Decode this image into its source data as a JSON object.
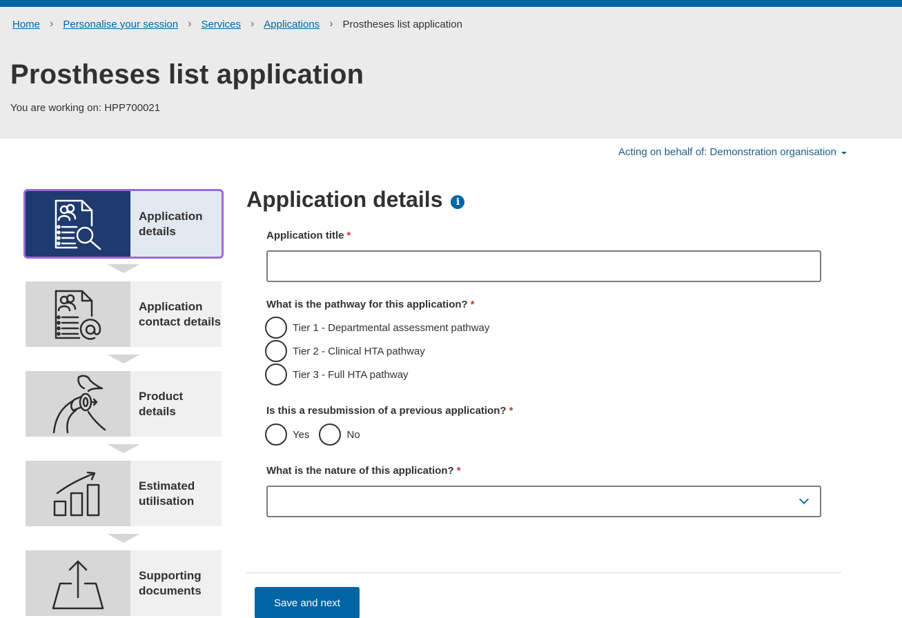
{
  "breadcrumb": {
    "items": [
      "Home",
      "Personalise your session",
      "Services",
      "Applications"
    ],
    "current": "Prostheses list application",
    "separator": "›"
  },
  "page": {
    "title": "Prostheses list application",
    "working_on": "You are working on: HPP700021"
  },
  "acting": {
    "label": "Acting on behalf of: Demonstration organisation"
  },
  "steps": [
    {
      "label": "Application details",
      "icon": "application-details-icon",
      "active": true
    },
    {
      "label": "Application contact details",
      "icon": "contact-details-icon",
      "active": false
    },
    {
      "label": "Product details",
      "icon": "hip-prosthesis-icon",
      "active": false
    },
    {
      "label": "Estimated utilisation",
      "icon": "bar-chart-growth-icon",
      "active": false
    },
    {
      "label": "Supporting documents",
      "icon": "upload-icon",
      "active": false
    }
  ],
  "form": {
    "section_title": "Application details",
    "info_glyph": "i",
    "required_mark": "*",
    "title_label": "Application title",
    "title_value": "",
    "pathway_label": "What is the pathway for this application?",
    "pathway_options": [
      "Tier 1 - Departmental assessment pathway",
      "Tier 2 - Clinical HTA pathway",
      "Tier 3 - Full HTA pathway"
    ],
    "resubmission_label": "Is this a resubmission of a previous application?",
    "resubmission_options": [
      "Yes",
      "No"
    ],
    "nature_label": "What is the nature of this application?",
    "nature_value": ""
  },
  "actions": {
    "save_next": "Save and next"
  },
  "colors": {
    "brand_blue": "#0065a4",
    "active_step": "#1f3a6e",
    "focus_outline": "#9a6bd5",
    "required": "#c0392b"
  }
}
